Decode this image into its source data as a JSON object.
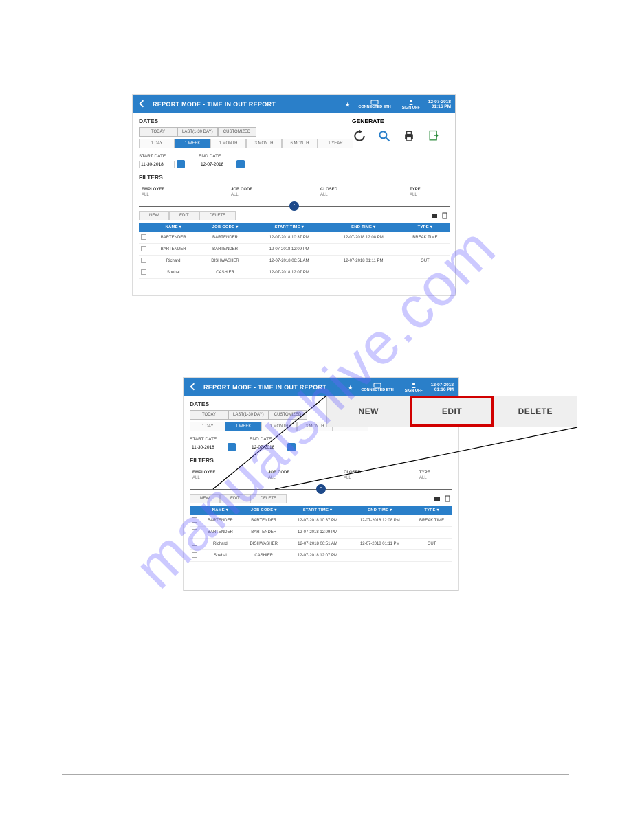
{
  "watermark": "manualshive.com",
  "header": {
    "title": "REPORT MODE - TIME IN OUT REPORT",
    "connected": "CONNECTED ETH",
    "signoff": "SIGN OFF",
    "date": "12-07-2018",
    "time": "01:16 PM"
  },
  "header2": {
    "title": "REPORT MODE - TIME IN OUT REPORT",
    "connected": "CONNECTED ETH",
    "signoff": "SIGN OFF",
    "date": "12-07-2018",
    "time": "01:16 PM"
  },
  "dates": {
    "label": "DATES",
    "tabs": {
      "today": "TODAY",
      "last30": "LAST(1-30 DAY)",
      "custom": "CUSTOMIZED"
    },
    "segs": {
      "d1": "1 DAY",
      "w1": "1 WEEK",
      "m1": "1 MONTH",
      "m3": "3 MONTH",
      "m6": "6 MONTH",
      "y1": "1 YEAR"
    },
    "start_lbl": "START DATE",
    "start_val": "11-30-2018",
    "end_lbl": "END DATE",
    "end_val": "12-07-2018"
  },
  "generate": {
    "label": "GENERATE"
  },
  "filters": {
    "label": "FILTERS",
    "employee_lbl": "EMPLOYEE",
    "employee_val": "ALL",
    "jobcode_lbl": "JOB CODE",
    "jobcode_val": "ALL",
    "closed_lbl": "CLOSED",
    "closed_val": "ALL",
    "type_lbl": "TYPE",
    "type_val": "ALL"
  },
  "actions": {
    "new": "NEW",
    "edit": "EDIT",
    "delete": "DELETE"
  },
  "callout": {
    "new": "NEW",
    "edit": "EDIT",
    "delete": "DELETE"
  },
  "grid": {
    "headers": {
      "name": "NAME ▾",
      "jobcode": "JOB CODE ▾",
      "start": "START TIME ▾",
      "end": "END TIME ▾",
      "type": "TYPE ▾"
    },
    "rows": [
      {
        "name": "BARTENDER",
        "jobcode": "BARTENDER",
        "start": "12-07-2018 10:37 PM",
        "end": "12-07-2018 12:08 PM",
        "type": "BREAK TIME"
      },
      {
        "name": "BARTENDER",
        "jobcode": "BARTENDER",
        "start": "12-07-2018 12:09 PM",
        "end": "",
        "type": ""
      },
      {
        "name": "Richard",
        "jobcode": "DISHWASHER",
        "start": "12-07-2018 06:51 AM",
        "end": "12-07-2018 01:11 PM",
        "type": "OUT"
      },
      {
        "name": "Snehal",
        "jobcode": "CASHIER",
        "start": "12-07-2018 12:07 PM",
        "end": "",
        "type": ""
      }
    ]
  }
}
